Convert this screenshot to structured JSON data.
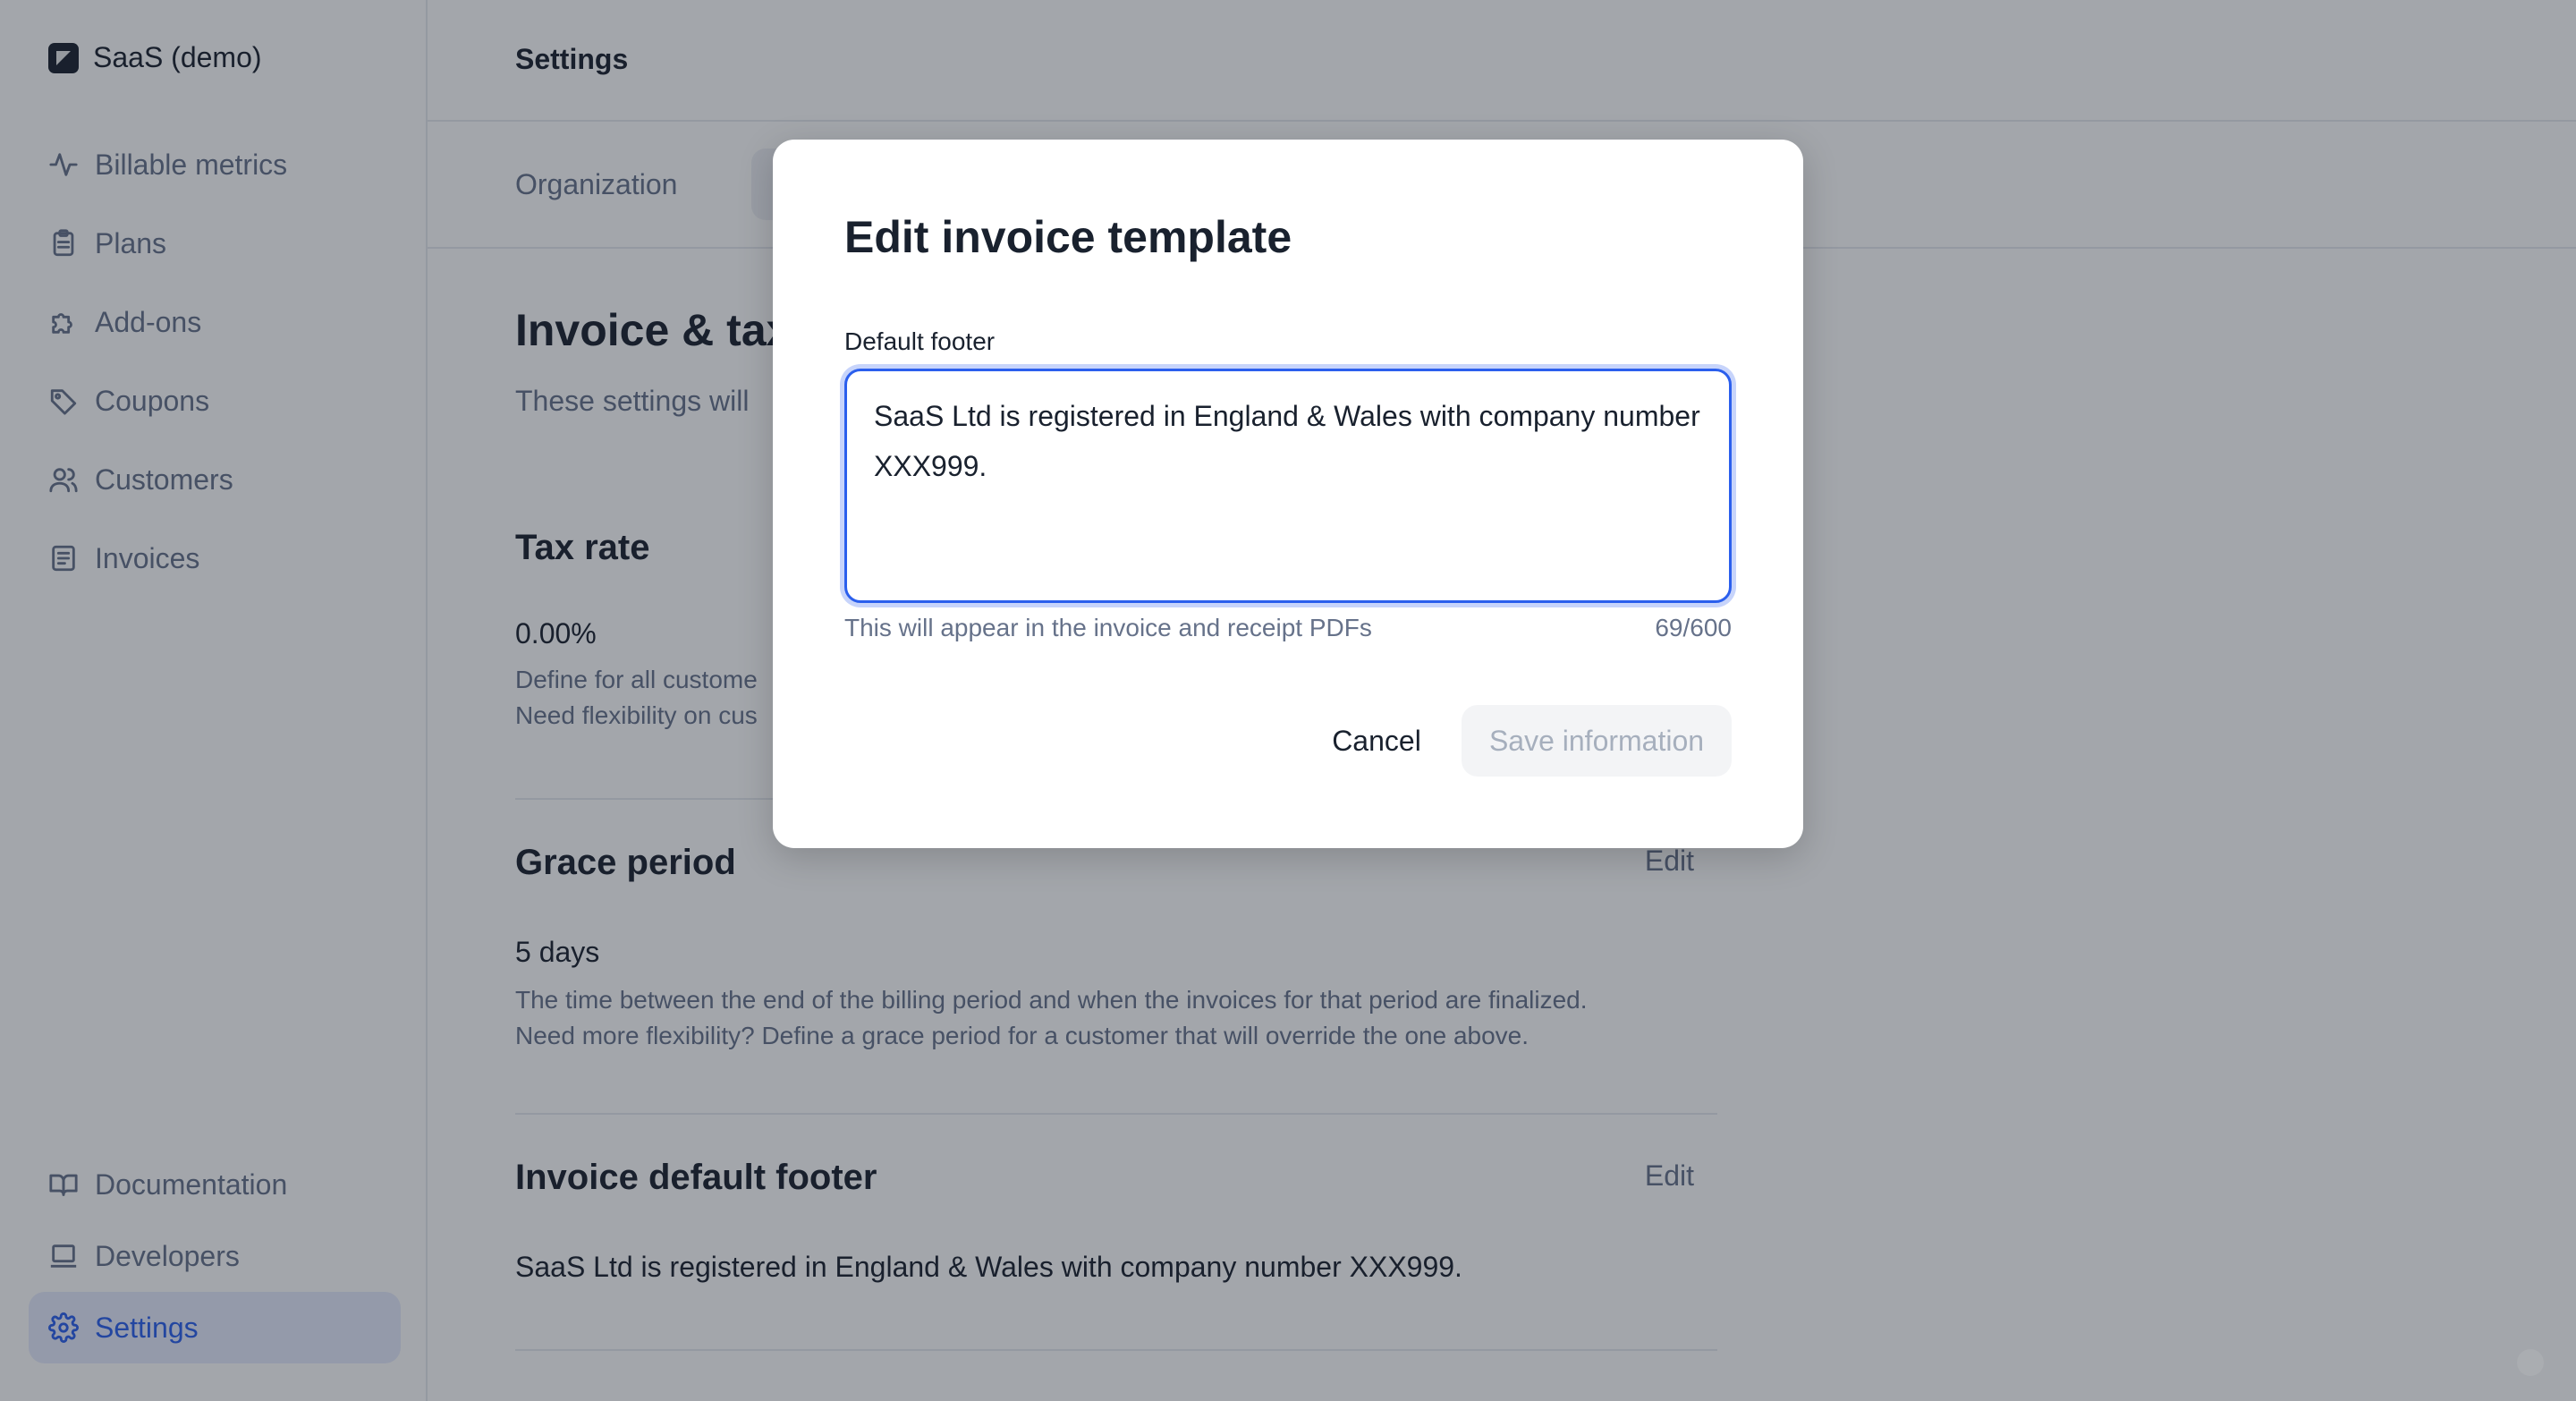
{
  "sidebar": {
    "org_name": "SaaS (demo)",
    "top_items": [
      {
        "label": "Billable metrics",
        "icon": "pulse-icon"
      },
      {
        "label": "Plans",
        "icon": "clipboard-icon"
      },
      {
        "label": "Add-ons",
        "icon": "puzzle-icon"
      },
      {
        "label": "Coupons",
        "icon": "tag-icon"
      },
      {
        "label": "Customers",
        "icon": "users-icon"
      },
      {
        "label": "Invoices",
        "icon": "document-icon"
      }
    ],
    "bottom_items": [
      {
        "label": "Documentation",
        "icon": "book-icon"
      },
      {
        "label": "Developers",
        "icon": "laptop-icon"
      },
      {
        "label": "Settings",
        "icon": "gear-icon",
        "active": true
      }
    ]
  },
  "header": {
    "title": "Settings"
  },
  "tabs": [
    {
      "label": "Organization"
    },
    {
      "label": ""
    }
  ],
  "main": {
    "title": "Invoice & tax",
    "subtitle": "These settings will",
    "tax_rate": {
      "heading": "Tax rate",
      "value": "0.00%",
      "desc_line1": "Define for all custome",
      "desc_line2": "Need flexibility on cus"
    },
    "grace_period": {
      "heading": "Grace period",
      "edit_label": "Edit",
      "value": "5 days",
      "desc_line1": "The time between the end of the billing period and when the invoices for that period are finalized.",
      "desc_line2": "Need more flexibility? Define a grace period for a customer that will override the one above."
    },
    "invoice_footer": {
      "heading": "Invoice default footer",
      "edit_label": "Edit",
      "value": "SaaS Ltd is registered in England & Wales with company number XXX999."
    }
  },
  "modal": {
    "title": "Edit invoice template",
    "field_label": "Default footer",
    "field_value": "SaaS Ltd is registered in England & Wales with company number XXX999.",
    "helper_text": "This will appear in the invoice and receipt PDFs",
    "counter": "69/600",
    "cancel_label": "Cancel",
    "save_label": "Save information"
  },
  "colors": {
    "accent": "#2b5fed",
    "text": "#19212e",
    "muted": "#66728a",
    "overlay": "rgba(25,33,46,0.4)"
  }
}
